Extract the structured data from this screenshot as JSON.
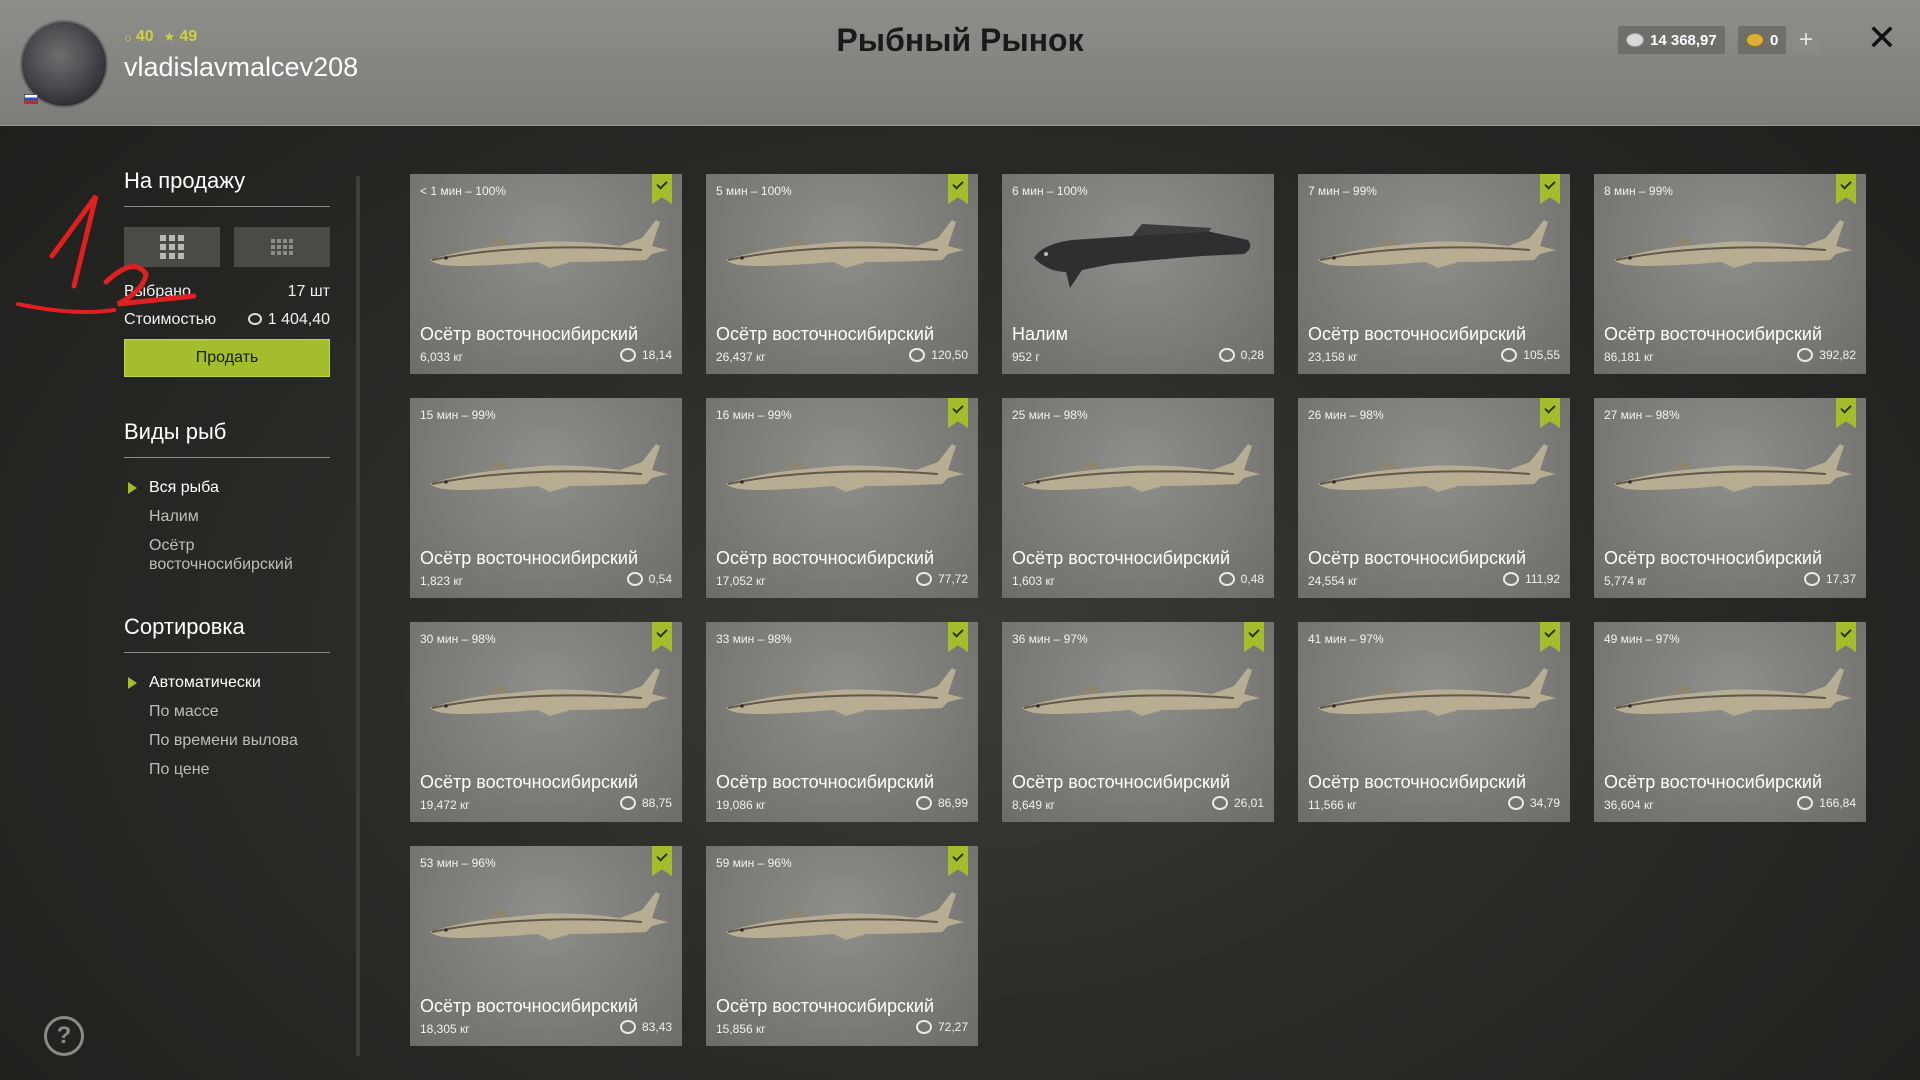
{
  "header": {
    "title": "Рыбный Рынок",
    "username": "vladislavmalcev208",
    "level_a": "40",
    "level_b": "49",
    "silver": "14 368,97",
    "gold": "0",
    "plus_label": "+",
    "close_label": "✕",
    "colors": {
      "accent": "#a3bd2c",
      "header_bg": "#858582"
    }
  },
  "sidebar": {
    "for_sale_title": "На продажу",
    "selected_label": "Выбрано",
    "selected_value": "17 шт",
    "cost_label": "Стоимостью",
    "cost_value": "1 404,40",
    "sell_button": "Продать",
    "species_title": "Виды рыб",
    "species": [
      "Вся рыба",
      "Налим",
      "Осётр восточносибирский"
    ],
    "sort_title": "Сортировка",
    "sorts": [
      "Автоматически",
      "По массе",
      "По времени вылова",
      "По цене"
    ],
    "annotation_text": "1 2"
  },
  "fish": [
    {
      "time": "< 1 мин – 100%",
      "name": "Осётр восточносибирский",
      "weight": "6,033 кг",
      "price": "18,14",
      "checked": true,
      "kind": "sturgeon"
    },
    {
      "time": "5 мин – 100%",
      "name": "Осётр восточносибирский",
      "weight": "26,437 кг",
      "price": "120,50",
      "checked": true,
      "kind": "sturgeon"
    },
    {
      "time": "6 мин – 100%",
      "name": "Налим",
      "weight": "952 г",
      "price": "0,28",
      "checked": false,
      "kind": "burbot"
    },
    {
      "time": "7 мин – 99%",
      "name": "Осётр восточносибирский",
      "weight": "23,158 кг",
      "price": "105,55",
      "checked": true,
      "kind": "sturgeon"
    },
    {
      "time": "8 мин – 99%",
      "name": "Осётр восточносибирский",
      "weight": "86,181 кг",
      "price": "392,82",
      "checked": true,
      "kind": "sturgeon"
    },
    {
      "time": "15 мин – 99%",
      "name": "Осётр восточносибирский",
      "weight": "1,823 кг",
      "price": "0,54",
      "checked": false,
      "kind": "sturgeon"
    },
    {
      "time": "16 мин – 99%",
      "name": "Осётр восточносибирский",
      "weight": "17,052 кг",
      "price": "77,72",
      "checked": true,
      "kind": "sturgeon"
    },
    {
      "time": "25 мин – 98%",
      "name": "Осётр восточносибирский",
      "weight": "1,603 кг",
      "price": "0,48",
      "checked": false,
      "kind": "sturgeon"
    },
    {
      "time": "26 мин – 98%",
      "name": "Осётр восточносибирский",
      "weight": "24,554 кг",
      "price": "111,92",
      "checked": true,
      "kind": "sturgeon"
    },
    {
      "time": "27 мин – 98%",
      "name": "Осётр восточносибирский",
      "weight": "5,774 кг",
      "price": "17,37",
      "checked": true,
      "kind": "sturgeon"
    },
    {
      "time": "30 мин – 98%",
      "name": "Осётр восточносибирский",
      "weight": "19,472 кг",
      "price": "88,75",
      "checked": true,
      "kind": "sturgeon"
    },
    {
      "time": "33 мин – 98%",
      "name": "Осётр восточносибирский",
      "weight": "19,086 кг",
      "price": "86,99",
      "checked": true,
      "kind": "sturgeon"
    },
    {
      "time": "36 мин – 97%",
      "name": "Осётр восточносибирский",
      "weight": "8,649 кг",
      "price": "26,01",
      "checked": true,
      "kind": "sturgeon"
    },
    {
      "time": "41 мин – 97%",
      "name": "Осётр восточносибирский",
      "weight": "11,566 кг",
      "price": "34,79",
      "checked": true,
      "kind": "sturgeon"
    },
    {
      "time": "49 мин – 97%",
      "name": "Осётр восточносибирский",
      "weight": "36,604 кг",
      "price": "166,84",
      "checked": true,
      "kind": "sturgeon"
    },
    {
      "time": "53 мин – 96%",
      "name": "Осётр восточносибирский",
      "weight": "18,305 кг",
      "price": "83,43",
      "checked": true,
      "kind": "sturgeon"
    },
    {
      "time": "59 мин – 96%",
      "name": "Осётр восточносибирский",
      "weight": "15,856 кг",
      "price": "72,27",
      "checked": true,
      "kind": "sturgeon"
    }
  ],
  "help_label": "?"
}
